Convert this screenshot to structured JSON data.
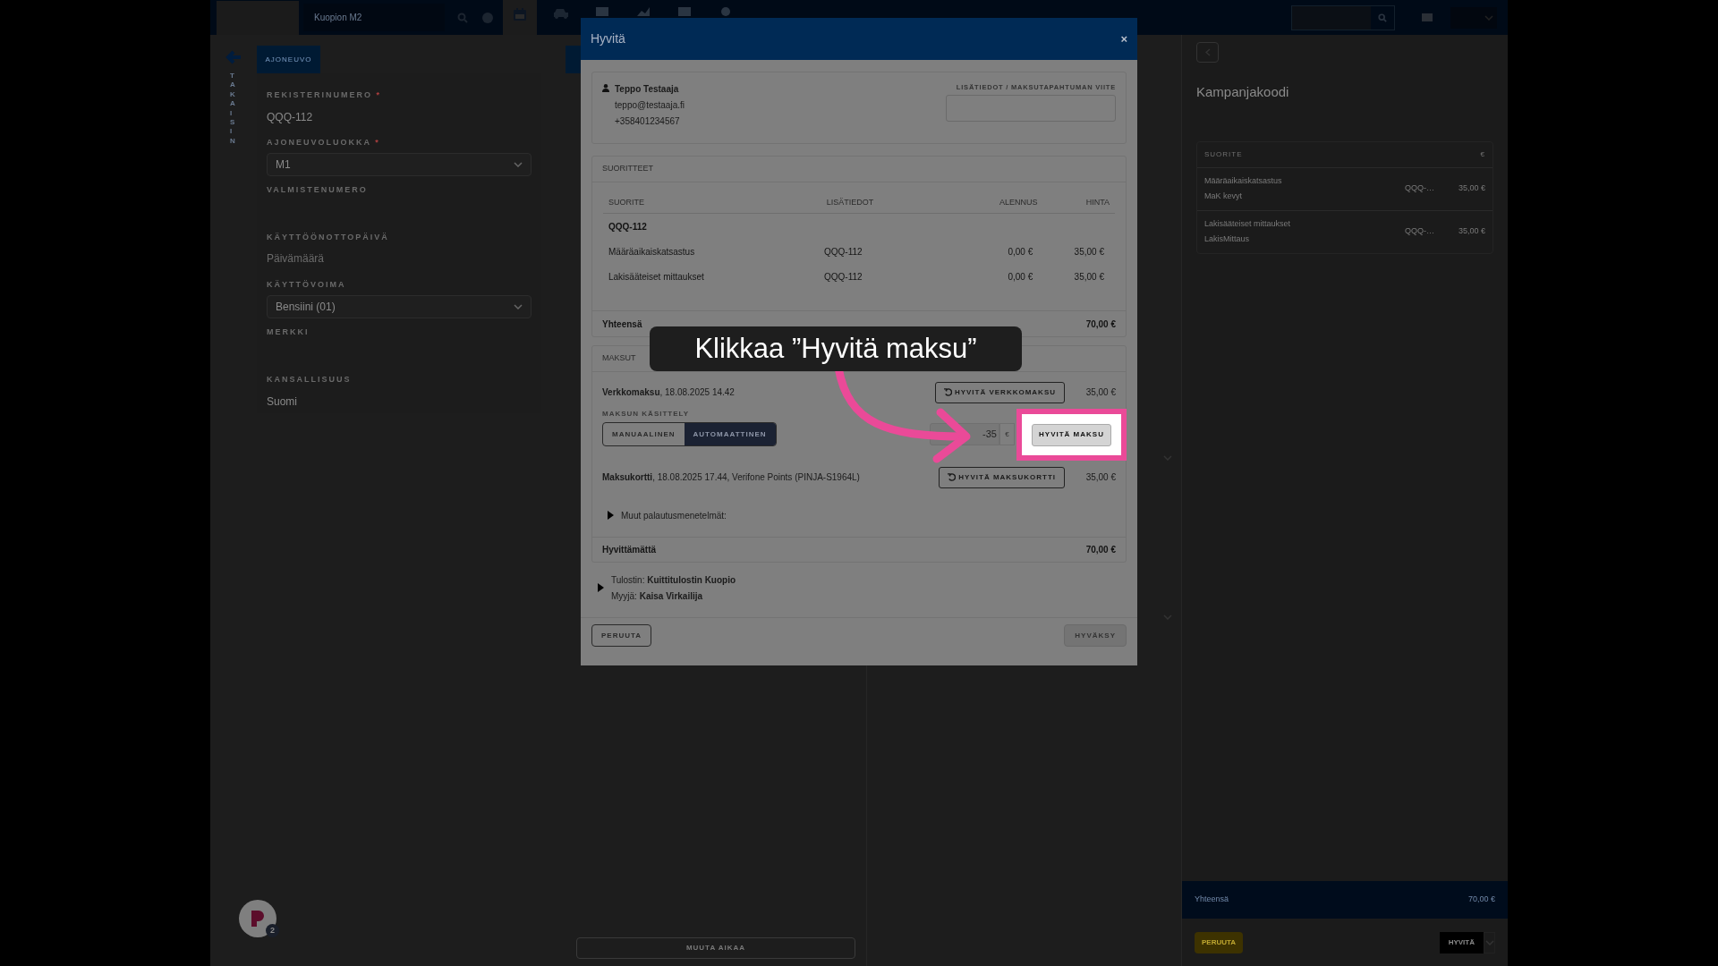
{
  "top_bar": {
    "location": "Kuopion M2",
    "nav": [
      {
        "kind": "calendar",
        "selected": true
      },
      {
        "kind": "car",
        "selected": false
      },
      {
        "kind": "box",
        "selected": false
      },
      {
        "kind": "chart",
        "selected": false
      },
      {
        "kind": "card",
        "selected": false
      },
      {
        "kind": "gear",
        "selected": false
      }
    ]
  },
  "left_panel": {
    "back_label": "TAKAISIN",
    "tab": "AJONEUVO",
    "fields": [
      {
        "label": "REKISTERINUMERO",
        "required_mark": "*",
        "kind": "text",
        "value": "QQQ-112"
      },
      {
        "label": "AJONEUVOLUOKKA",
        "required_mark": "*",
        "kind": "select",
        "value": "M1"
      },
      {
        "label": "VALMISTENUMERO",
        "kind": "text"
      },
      {
        "label": "KÄYTTÖÖNOTTOPÄIVÄ",
        "kind": "date",
        "placeholder": "Päivämäärä"
      },
      {
        "label": "KÄYTTÖVOIMA",
        "kind": "select",
        "value": "Bensiini (01)"
      },
      {
        "label": "MERKKI",
        "kind": "text"
      },
      {
        "label": "KANSALLISUUS",
        "kind": "text",
        "value": "Suomi"
      }
    ]
  },
  "middle_panel": {
    "button": "MUUTA AIKAA"
  },
  "right_panel": {
    "title": "Kampanjakoodi",
    "columns": [
      "SUORITE",
      "€"
    ],
    "rows": [
      {
        "name": "Määräaikaiskatsastus",
        "code": "MaK kevyt",
        "info": "QQQ-…",
        "price": "35,00 €"
      },
      {
        "name": "Lakisääteiset mittaukset",
        "code": "LakisMittaus",
        "info": "QQQ-…",
        "price": "35,00 €"
      }
    ],
    "total_label": "Yhteensä",
    "total": "70,00 €",
    "cancel_button": "PERUUTA",
    "confirm_button": "HYVITÄ"
  },
  "chat_badge": "2",
  "dialog": {
    "title": "Hyvitä",
    "close": "×",
    "customer": {
      "name": "Teppo Testaaja",
      "email": "teppo@testaaja.fi",
      "phone": "+358401234567"
    },
    "reference_label": "LISÄTIEDOT / MAKSUTAPAHTUMAN VIITE",
    "products": {
      "heading": "SUORITTEET",
      "columns": [
        "SUORITE",
        "LISÄTIEDOT",
        "ALENNUS",
        "HINTA"
      ],
      "group": "QQQ-112",
      "rows": [
        {
          "name": "Määräaikaiskatsastus",
          "info": "QQQ-112",
          "discount": "0,00 €",
          "price": "35,00 €"
        },
        {
          "name": "Lakisääteiset mittaukset",
          "info": "QQQ-112",
          "discount": "0,00 €",
          "price": "35,00 €"
        }
      ],
      "total_label": "Yhteensä",
      "total": "70,00 €"
    },
    "payments": {
      "heading": "MAKSUT",
      "items": [
        {
          "text": "**Verkkomaksu**, 18.08.2025 14.42",
          "button": "HYVITÄ VERKKOMAKSU",
          "amount": "35,00 €",
          "handling": {
            "label": "MAKSUN KÄSITTELY",
            "options": [
              {
                "label": "MANUAALINEN",
                "selected": false
              },
              {
                "label": "AUTOMAATTINEN",
                "selected": true
              }
            ],
            "value": "-35",
            "currency": "€",
            "button": "HYVITÄ MAKSU"
          }
        },
        {
          "text": "**Maksukortti**, 18.08.2025 17.44, Verifone Points (PINJA-S1964L)",
          "button": "HYVITÄ MAKSUKORTTI",
          "amount": "35,00 €"
        }
      ],
      "other_methods": {
        "label": "Muut palautusmenetelmät:",
        "expanded": false
      },
      "remaining_label": "Hyvittämättä",
      "remaining": "70,00 €"
    },
    "receipt": {
      "text": "Tulostin: **Kuittitulostin Kuopio**",
      "seller": "Myyjä: **Kaisa Virkailija**",
      "expanded": false
    },
    "cancel": "PERUUTA",
    "confirm": "HYVÄKSY",
    "confirm_disabled": true
  },
  "tutorial": {
    "callout": "Klikkaa ”Hyvitä maksu”"
  }
}
